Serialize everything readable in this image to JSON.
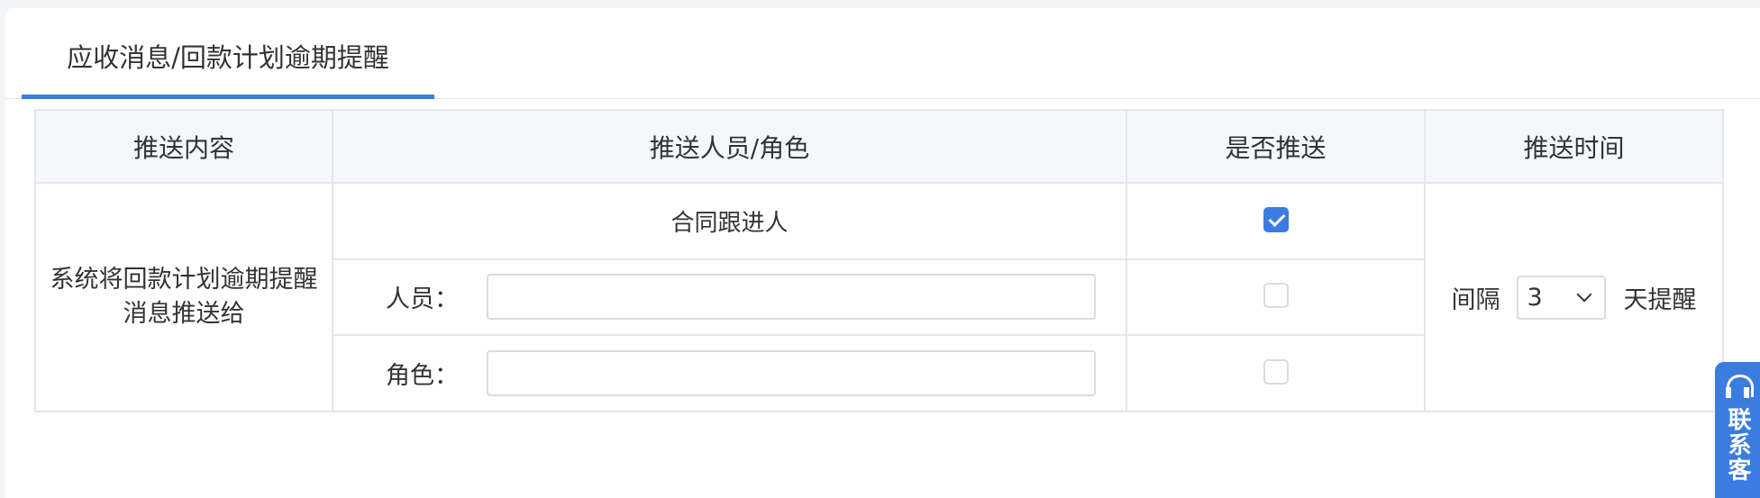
{
  "tab": {
    "label": "应收消息/回款计划逾期提醒"
  },
  "table": {
    "headers": [
      "推送内容",
      "推送人员/角色",
      "是否推送",
      "推送时间"
    ],
    "content": "系统将回款计划逾期提醒消息推送给",
    "content_line1": "系统将回款计划逾期提醒",
    "content_line2": "消息推送给",
    "rows": [
      {
        "recipient": "合同跟进人",
        "push": true
      },
      {
        "label": "人员：",
        "value": "",
        "placeholder": "",
        "push": false
      },
      {
        "label": "角色：",
        "value": "",
        "placeholder": "",
        "push": false
      }
    ],
    "interval": {
      "prefix": "间隔",
      "value": "3",
      "suffix": "天提醒"
    }
  },
  "support": {
    "label": "联系客",
    "icon": "headset-icon"
  },
  "colors": {
    "accent": "#3a7ce0",
    "header_bg": "#f4f7fb",
    "border": "#e3e6ec"
  }
}
